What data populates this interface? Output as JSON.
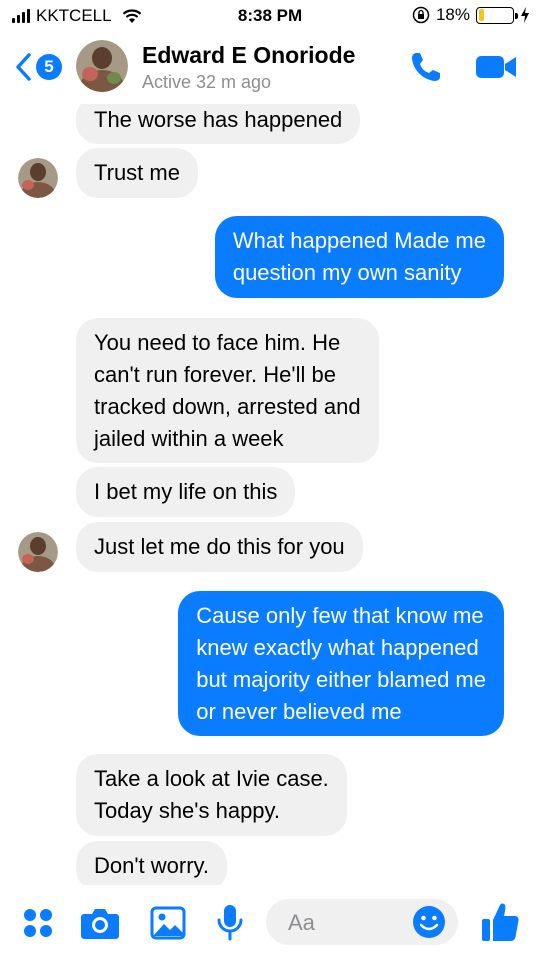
{
  "status_bar": {
    "carrier": "KKTCELL",
    "time": "8:38 PM",
    "battery_text": "18%",
    "battery_level": 0.18
  },
  "header": {
    "unread_count": "5",
    "contact_name": "Edward E Onoriode",
    "active_status": "Active 32 m ago"
  },
  "messages": [
    {
      "side": "in",
      "lines": [
        "The worse has happened"
      ]
    },
    {
      "side": "in",
      "lines": [
        "Trust me"
      ]
    },
    {
      "side": "out",
      "lines": [
        "What happened Made me",
        "question my own sanity"
      ]
    },
    {
      "side": "in",
      "lines": [
        "You need to face him. He",
        "can't run forever. He'll be",
        "tracked down, arrested and",
        "jailed within a week"
      ]
    },
    {
      "side": "in",
      "lines": [
        "I bet my life on this"
      ]
    },
    {
      "side": "in",
      "lines": [
        "Just let me do this for you"
      ]
    },
    {
      "side": "out",
      "lines": [
        "Cause only few that know me",
        "knew exactly what happened",
        "but majority either blamed me",
        "or never believed me"
      ]
    },
    {
      "side": "in",
      "lines": [
        "Take a look at Ivie case.",
        "Today she's happy."
      ]
    },
    {
      "side": "in",
      "lines": [
        "Don't worry."
      ]
    }
  ],
  "composer": {
    "placeholder": "Aa"
  },
  "colors": {
    "messenger_blue": "#0a7cff",
    "incoming_bubble": "#f1f0f0",
    "battery_fill": "#f5c518"
  },
  "icons": [
    "signal-icon",
    "wifi-icon",
    "orientation-lock-icon",
    "battery-icon",
    "charging-bolt-icon",
    "back-chevron-icon",
    "phone-icon",
    "video-camera-icon",
    "apps-grid-icon",
    "camera-icon",
    "image-icon",
    "microphone-icon",
    "emoji-icon",
    "thumbs-up-icon"
  ]
}
